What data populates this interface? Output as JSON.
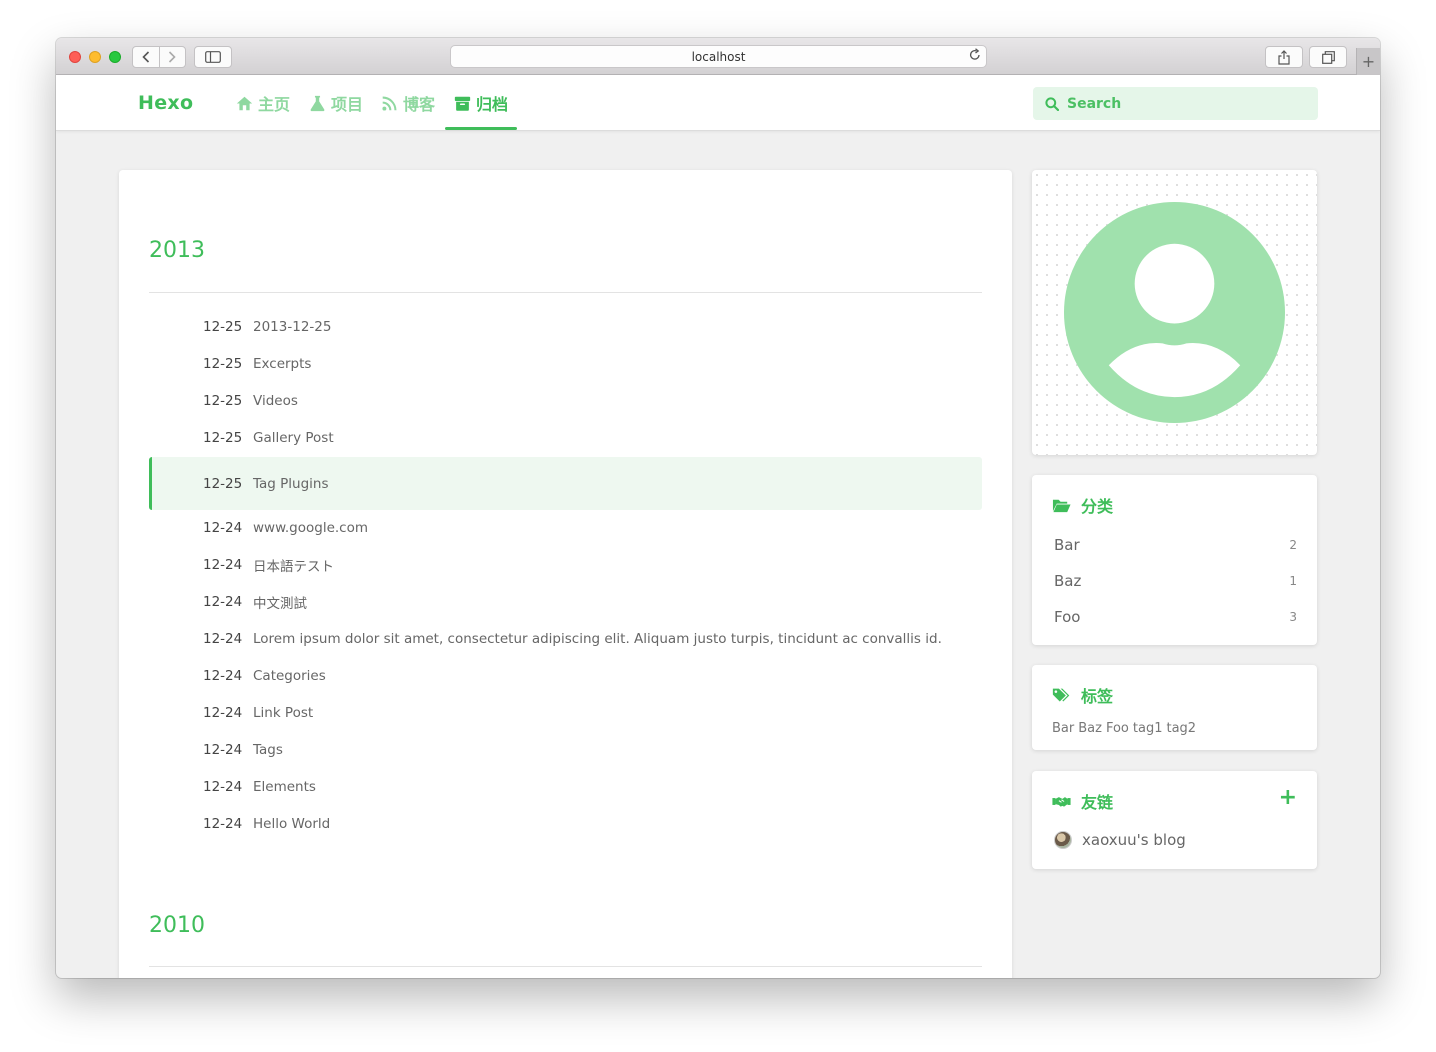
{
  "browser": {
    "address": "localhost"
  },
  "site": {
    "brand": "Hexo",
    "nav": [
      {
        "label": "主页",
        "icon": "home-icon"
      },
      {
        "label": "项目",
        "icon": "flask-icon"
      },
      {
        "label": "博客",
        "icon": "rss-icon"
      },
      {
        "label": "归档",
        "icon": "archive-icon",
        "active": true
      }
    ],
    "search_placeholder": "Search"
  },
  "archive": {
    "years": [
      {
        "year": "2013",
        "posts": [
          {
            "date": "12-25",
            "title": "2013-12-25"
          },
          {
            "date": "12-25",
            "title": "Excerpts"
          },
          {
            "date": "12-25",
            "title": "Videos"
          },
          {
            "date": "12-25",
            "title": "Gallery Post"
          },
          {
            "date": "12-25",
            "title": "Tag Plugins",
            "highlighted": true
          },
          {
            "date": "12-24",
            "title": "www.google.com"
          },
          {
            "date": "12-24",
            "title": "日本語テスト"
          },
          {
            "date": "12-24",
            "title": "中文測試"
          },
          {
            "date": "12-24",
            "title": "Lorem ipsum dolor sit amet, consectetur adipiscing elit. Aliquam justo turpis, tincidunt ac convallis id."
          },
          {
            "date": "12-24",
            "title": "Categories"
          },
          {
            "date": "12-24",
            "title": "Link Post"
          },
          {
            "date": "12-24",
            "title": "Tags"
          },
          {
            "date": "12-24",
            "title": "Elements"
          },
          {
            "date": "12-24",
            "title": "Hello World"
          }
        ]
      },
      {
        "year": "2010",
        "posts": []
      }
    ]
  },
  "sidebar": {
    "categories": {
      "title": "分类",
      "items": [
        {
          "name": "Bar",
          "count": "2"
        },
        {
          "name": "Baz",
          "count": "1"
        },
        {
          "name": "Foo",
          "count": "3"
        }
      ]
    },
    "tags": {
      "title": "标签",
      "items": [
        "Bar",
        "Baz",
        "Foo",
        "tag1",
        "tag2"
      ]
    },
    "friends": {
      "title": "友链",
      "add_label": "+",
      "items": [
        {
          "name": "xaoxuu's blog"
        }
      ]
    }
  },
  "colors": {
    "accent": "#3fbd5a",
    "accent_light": "#8fd8a0",
    "avatar": "#a0e1ad"
  }
}
